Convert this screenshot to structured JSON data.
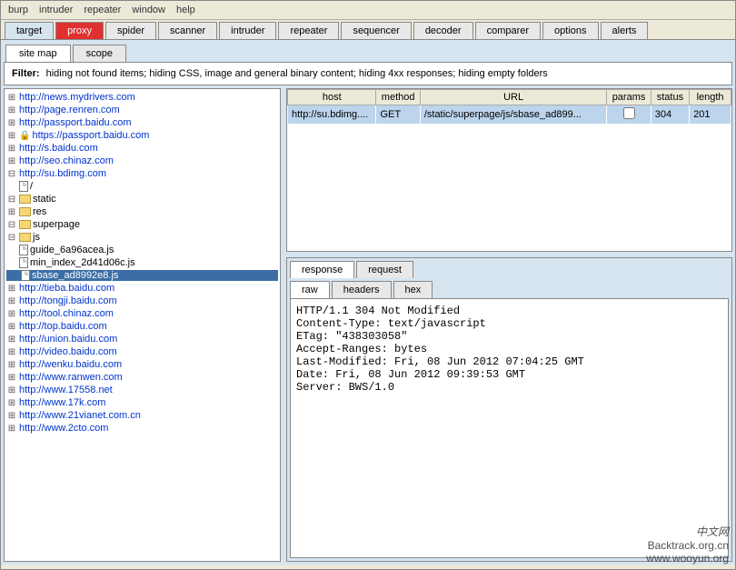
{
  "menu": [
    "burp",
    "intruder",
    "repeater",
    "window",
    "help"
  ],
  "main_tabs": [
    "target",
    "proxy",
    "spider",
    "scanner",
    "intruder",
    "repeater",
    "sequencer",
    "decoder",
    "comparer",
    "options",
    "alerts"
  ],
  "main_active": "target",
  "main_highlight": "proxy",
  "sub_tabs": [
    "site map",
    "scope"
  ],
  "sub_active": "site map",
  "filter": {
    "label": "Filter:",
    "text": "hiding not found items;  hiding CSS, image and general binary content;  hiding 4xx responses;  hiding empty folders"
  },
  "tree": [
    {
      "t": "http://news.mydrivers.com",
      "l": 0,
      "x": "o"
    },
    {
      "t": "http://page.renren.com",
      "l": 0,
      "x": "o"
    },
    {
      "t": "http://passport.baidu.com",
      "l": 0,
      "x": "o"
    },
    {
      "t": "https://passport.baidu.com",
      "l": 0,
      "x": "o",
      "lock": true
    },
    {
      "t": "http://s.baidu.com",
      "l": 0,
      "x": "o"
    },
    {
      "t": "http://seo.chinaz.com",
      "l": 0,
      "x": "o"
    },
    {
      "t": "http://su.bdimg.com",
      "l": 0,
      "x": "q"
    },
    {
      "t": "/",
      "l": 1,
      "x": "",
      "icon": "file"
    },
    {
      "t": "static",
      "l": 1,
      "x": "q",
      "icon": "folder"
    },
    {
      "t": "res",
      "l": 2,
      "x": "o",
      "icon": "folder"
    },
    {
      "t": "superpage",
      "l": 2,
      "x": "q",
      "icon": "folder"
    },
    {
      "t": "js",
      "l": 3,
      "x": "q",
      "icon": "folder"
    },
    {
      "t": "guide_6a96acea.js",
      "l": 4,
      "x": "",
      "icon": "file"
    },
    {
      "t": "min_index_2d41d06c.js",
      "l": 4,
      "x": "",
      "icon": "file"
    },
    {
      "t": "sbase_ad8992e8.js",
      "l": 4,
      "x": "",
      "icon": "file",
      "sel": true
    },
    {
      "t": "http://tieba.baidu.com",
      "l": 0,
      "x": "o"
    },
    {
      "t": "http://tongji.baidu.com",
      "l": 0,
      "x": "o"
    },
    {
      "t": "http://tool.chinaz.com",
      "l": 0,
      "x": "o"
    },
    {
      "t": "http://top.baidu.com",
      "l": 0,
      "x": "o"
    },
    {
      "t": "http://union.baidu.com",
      "l": 0,
      "x": "o"
    },
    {
      "t": "http://video.baidu.com",
      "l": 0,
      "x": "o"
    },
    {
      "t": "http://wenku.baidu.com",
      "l": 0,
      "x": "o"
    },
    {
      "t": "http://www.ranwen.com",
      "l": 0,
      "x": "o"
    },
    {
      "t": "http://www.17558.net",
      "l": 0,
      "x": "o"
    },
    {
      "t": "http://www.17k.com",
      "l": 0,
      "x": "o"
    },
    {
      "t": "http://www.21vianet.com.cn",
      "l": 0,
      "x": "o"
    },
    {
      "t": "http://www.2cto.com",
      "l": 0,
      "x": "o"
    }
  ],
  "req_headers": [
    "host",
    "method",
    "URL",
    "params",
    "status",
    "length"
  ],
  "req_row": {
    "host": "http://su.bdimg....",
    "method": "GET",
    "url": "/static/superpage/js/sbase_ad899...",
    "params": "",
    "status": "304",
    "length": "201"
  },
  "resp_tabs": [
    "response",
    "request"
  ],
  "resp_active": "response",
  "view_tabs": [
    "raw",
    "headers",
    "hex"
  ],
  "view_active": "raw",
  "response_raw": "HTTP/1.1 304 Not Modified\nContent-Type: text/javascript\nETag: \"438303058\"\nAccept-Ranges: bytes\nLast-Modified: Fri, 08 Jun 2012 07:04:25 GMT\nDate: Fri, 08 Jun 2012 09:39:53 GMT\nServer: BWS/1.0",
  "watermark": {
    "cn": "中文网",
    "en1": "Backtrack.org.cn",
    "en2": "www.wooyun.org"
  }
}
